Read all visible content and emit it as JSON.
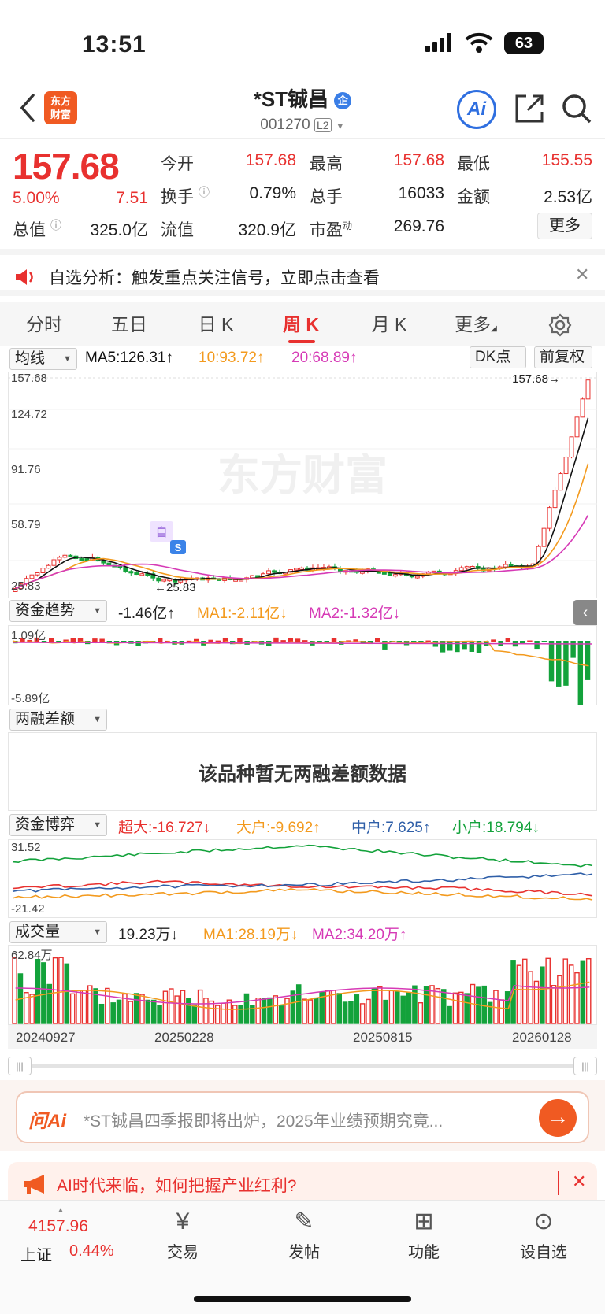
{
  "status": {
    "time": "13:51",
    "battery": "63"
  },
  "header": {
    "logo_text": "东方\n财富",
    "stock_name": "*ST铖昌",
    "stock_code": "001270",
    "level": "L2",
    "ent_badge": "企",
    "ai_label": "Ai"
  },
  "quote": {
    "price": "157.68",
    "change_pct": "5.00%",
    "change": "7.51",
    "fields": {
      "open_label": "今开",
      "open": "157.68",
      "high_label": "最高",
      "high": "157.68",
      "low_label": "最低",
      "low": "155.55",
      "turnover_label": "换手",
      "turnover": "0.79%",
      "volume_label": "总手",
      "volume": "16033",
      "amount_label": "金额",
      "amount": "2.53亿",
      "mktcap_label": "总值",
      "mktcap": "325.0亿",
      "float_label": "流值",
      "float": "320.9亿",
      "pe_label": "市盈",
      "pe_sup": "动",
      "pe": "269.76"
    },
    "more_label": "更多"
  },
  "notice": {
    "text": "自选分析：触发重点关注信号，立即点击查看"
  },
  "tabs": [
    {
      "label": "分时"
    },
    {
      "label": "五日"
    },
    {
      "label": "日 K"
    },
    {
      "label": "周 K",
      "active": true
    },
    {
      "label": "月 K"
    },
    {
      "label": "更多"
    }
  ],
  "kline": {
    "selector": "均线",
    "ma5": "MA5:126.31↑",
    "ma10": "10:93.72↑",
    "ma20": "20:68.89↑",
    "dk_label": "DK点",
    "adj_label": "前复权",
    "ticks": [
      "157.68",
      "124.72",
      "91.76",
      "58.79",
      "25.83"
    ],
    "max_label": "157.68→",
    "min_label": "←25.83",
    "watermark": "东方财富",
    "marker_zi": "自",
    "marker_s": "S",
    "colors": {
      "up": "#e8312f",
      "down": "#13a23b",
      "ma5": "#111111",
      "ma10": "#f39a1e",
      "ma20": "#d63ab6"
    }
  },
  "fund_trend": {
    "selector": "资金趋势",
    "value": "-1.46亿↑",
    "ma1": "MA1:-2.11亿↓",
    "ma2": "MA2:-1.32亿↓",
    "ticks": [
      "1.09亿",
      "-5.89亿"
    ]
  },
  "margin": {
    "selector": "两融差额",
    "empty_text": "该品种暂无两融差额数据"
  },
  "fund_game": {
    "selector": "资金博弈",
    "super": "超大:-16.727↓",
    "large": "大户:-9.692↑",
    "medium": "中户:7.625↑",
    "small": "小户:18.794↓",
    "ticks": [
      "31.52",
      "-21.42"
    ]
  },
  "volume": {
    "selector": "成交量",
    "value": "19.23万↓",
    "ma1": "MA1:28.19万↓",
    "ma2": "MA2:34.20万↑",
    "ticks": [
      "62.84万"
    ],
    "dates": [
      "20240927",
      "20250228",
      "20250815",
      "20260128"
    ]
  },
  "ai_bar": {
    "brand": "问Ai",
    "placeholder": "*ST铖昌四季报即将出炉，2025年业绩预期究竟..."
  },
  "promo": {
    "text": "AI时代来临，如何把握产业红利?"
  },
  "bottom_nav": {
    "index_value": "4157.96",
    "index_name": "上证",
    "index_pct": "0.44%",
    "items": [
      {
        "label": "交易",
        "icon": "yen-cycle-icon"
      },
      {
        "label": "发帖",
        "icon": "edit-icon"
      },
      {
        "label": "功能",
        "icon": "apps-icon"
      },
      {
        "label": "设自选",
        "icon": "more-circle-icon"
      }
    ]
  }
}
